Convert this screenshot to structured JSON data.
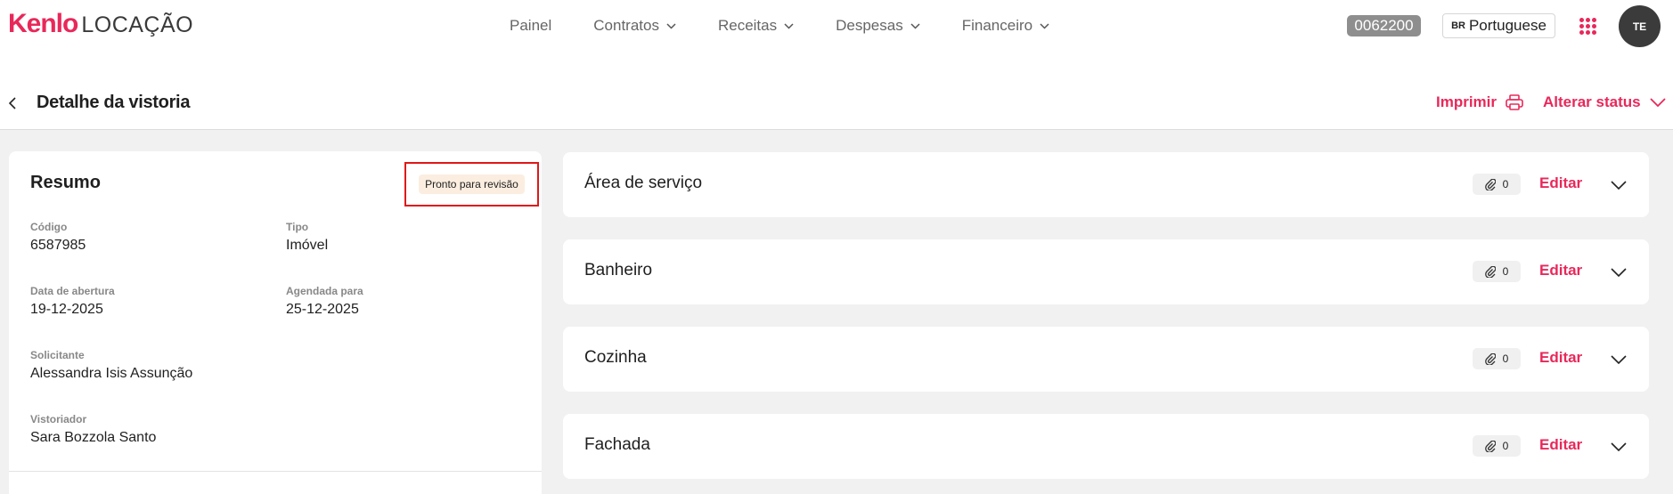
{
  "app": {
    "brand": "Kenlo",
    "product": "LOCAÇÃO"
  },
  "nav": {
    "items": [
      {
        "label": "Painel",
        "has_dropdown": false
      },
      {
        "label": "Contratos",
        "has_dropdown": true
      },
      {
        "label": "Receitas",
        "has_dropdown": true
      },
      {
        "label": "Despesas",
        "has_dropdown": true
      },
      {
        "label": "Financeiro",
        "has_dropdown": true
      }
    ]
  },
  "header_right": {
    "account_code": "0062200",
    "language_flag": "BR",
    "language": "Portuguese",
    "avatar_initials": "TE"
  },
  "page": {
    "title": "Detalhe da vistoria",
    "print_label": "Imprimir",
    "status_label": "Alterar status"
  },
  "summary": {
    "title": "Resumo",
    "status_badge": "Pronto para revisão",
    "fields": {
      "codigo": {
        "label": "Código",
        "value": "6587985"
      },
      "tipo": {
        "label": "Tipo",
        "value": "Imóvel"
      },
      "data_abertura": {
        "label": "Data de abertura",
        "value": "19-12-2025"
      },
      "agendada": {
        "label": "Agendada para",
        "value": "25-12-2025"
      },
      "solicitante": {
        "label": "Solicitante",
        "value": "Alessandra Isis Assunção"
      },
      "vistoriador": {
        "label": "Vistoriador",
        "value": "Sara Bozzola Santo"
      }
    }
  },
  "sections": [
    {
      "name": "Área de serviço",
      "attachments": "0",
      "edit_label": "Editar"
    },
    {
      "name": "Banheiro",
      "attachments": "0",
      "edit_label": "Editar"
    },
    {
      "name": "Cozinha",
      "attachments": "0",
      "edit_label": "Editar"
    },
    {
      "name": "Fachada",
      "attachments": "0",
      "edit_label": "Editar"
    }
  ],
  "colors": {
    "accent": "#e8285a",
    "badge_bg": "#fbeee0",
    "highlight_border": "#e01818",
    "account_badge_bg": "#8e8e8e",
    "avatar_bg": "#3b3b3b"
  }
}
